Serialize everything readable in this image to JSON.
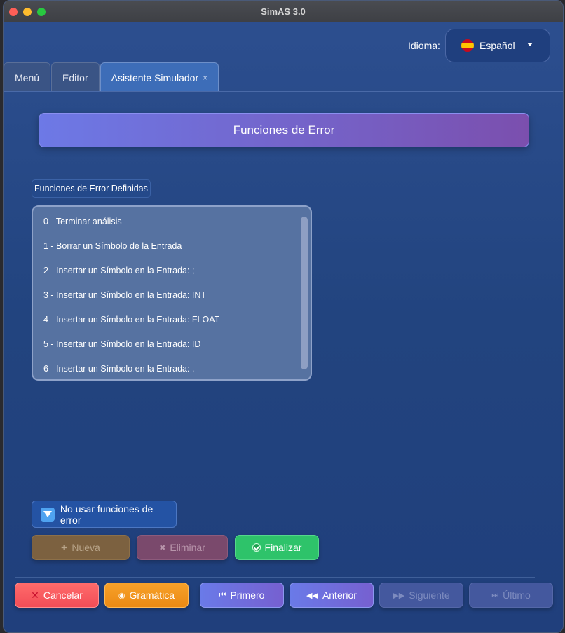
{
  "window": {
    "title": "SimAS 3.0"
  },
  "language": {
    "label": "Idioma:",
    "value": "Español"
  },
  "tabs": [
    {
      "label": "Menú"
    },
    {
      "label": "Editor"
    },
    {
      "label": "Asistente Simulador",
      "close": "×"
    }
  ],
  "section": {
    "title": "Funciones de Error"
  },
  "error_functions": {
    "group_label": "Funciones de Error Definidas",
    "items": [
      "0 - Terminar análisis",
      "1 - Borrar un Símbolo de la Entrada",
      "2 - Insertar un Símbolo en la Entrada: ;",
      "3 - Insertar un Símbolo en la Entrada: INT",
      "4 - Insertar un Símbolo en la Entrada: FLOAT",
      "5 - Insertar un Símbolo en la Entrada: ID",
      "6 - Insertar un Símbolo en la Entrada: ,"
    ]
  },
  "options": {
    "no_error_functions": "No usar funciones de error"
  },
  "actions": {
    "new": "Nueva",
    "delete": "Eliminar",
    "finish": "Finalizar"
  },
  "footer": {
    "cancel": "Cancelar",
    "grammar": "Gramática",
    "first": "Primero",
    "previous": "Anterior",
    "next": "Siguiente",
    "last": "Último"
  }
}
